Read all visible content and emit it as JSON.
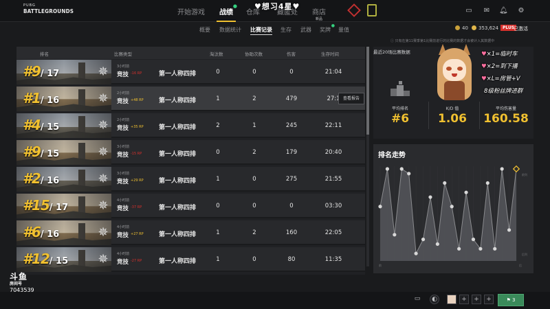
{
  "brand": {
    "small": "PUBG",
    "big": "BATTLEGROUNDS"
  },
  "nav": {
    "tabs": [
      {
        "label": "开始游戏"
      },
      {
        "label": "战绩"
      },
      {
        "label": "仓库"
      },
      {
        "label": "藏匿处"
      },
      {
        "label": "商店",
        "badge": "新品"
      }
    ]
  },
  "overlay_title": "♥想习4星♥",
  "subnav": [
    "概要",
    "数据统计",
    "比赛记录",
    "生存",
    "武器",
    "奖牌",
    "量值"
  ],
  "currency": {
    "bp": "40",
    "gcoin": "353,624"
  },
  "plus": {
    "badge": "PLUS",
    "status": "已激活"
  },
  "notice": "ⓘ 只有在第11赛季第1比赛前进行的比赛的数据才会被计入其数据中",
  "table": {
    "headers": [
      "排名",
      "比赛类型",
      "淘汰数",
      "协助次数",
      "伤害",
      "生存时间"
    ],
    "report_label": "查看报告",
    "rows": [
      {
        "rank": "#9",
        "total": "/ 17",
        "ago": "3小时前",
        "mode": "竞技",
        "rp": "-16 RP",
        "rp_dir": "down",
        "type": "第一人称四排",
        "kills": "0",
        "assists": "0",
        "damage": "0",
        "time": "21:04",
        "snow": false
      },
      {
        "rank": "#1",
        "total": "/ 16",
        "ago": "2小时前",
        "mode": "竞技",
        "rp": "+48 RP",
        "rp_dir": "up",
        "type": "第一人称四排",
        "kills": "1",
        "assists": "2",
        "damage": "479",
        "time": "27:1",
        "snow": true,
        "selected": true
      },
      {
        "rank": "#4",
        "total": "/ 15",
        "ago": "2小时前",
        "mode": "竞技",
        "rp": "+35 RP",
        "rp_dir": "up",
        "type": "第一人称四排",
        "kills": "2",
        "assists": "1",
        "damage": "245",
        "time": "22:11",
        "snow": false
      },
      {
        "rank": "#9",
        "total": "/ 15",
        "ago": "3小时前",
        "mode": "竞技",
        "rp": "-15 RP",
        "rp_dir": "down",
        "type": "第一人称四排",
        "kills": "0",
        "assists": "2",
        "damage": "179",
        "time": "20:40",
        "snow": true
      },
      {
        "rank": "#2",
        "total": "/ 16",
        "ago": "3小时前",
        "mode": "竞技",
        "rp": "+29 RP",
        "rp_dir": "up",
        "type": "第一人称四排",
        "kills": "1",
        "assists": "0",
        "damage": "275",
        "time": "21:55",
        "snow": false
      },
      {
        "rank": "#15",
        "total": "/ 17",
        "ago": "4小时前",
        "mode": "竞技",
        "rp": "-37 RP",
        "rp_dir": "down",
        "type": "第一人称四排",
        "kills": "0",
        "assists": "0",
        "damage": "0",
        "time": "03:30",
        "snow": true
      },
      {
        "rank": "#6",
        "total": "/ 16",
        "ago": "4小时前",
        "mode": "竞技",
        "rp": "+27 RP",
        "rp_dir": "up",
        "type": "第一人称四排",
        "kills": "1",
        "assists": "2",
        "damage": "160",
        "time": "22:05",
        "snow": true
      },
      {
        "rank": "#12",
        "total": "/ 15",
        "ago": "4小时前",
        "mode": "竞技",
        "rp": "-27 RP",
        "rp_dir": "down",
        "type": "第一人称四排",
        "kills": "1",
        "assists": "0",
        "damage": "80",
        "time": "11:35",
        "snow": false
      }
    ]
  },
  "stats": {
    "title": "最近20场比赛数据",
    "items": [
      {
        "label": "平均排名",
        "value": "#6"
      },
      {
        "label": "K/D 值",
        "value": "1.06"
      },
      {
        "label": "平均伤害量",
        "value": "160.58"
      }
    ]
  },
  "chart_data": {
    "type": "line",
    "title": "排名走势",
    "x": [
      1,
      2,
      3,
      4,
      5,
      6,
      7,
      8,
      9,
      10,
      11,
      12,
      13,
      14,
      15,
      16,
      17,
      18,
      19,
      20
    ],
    "series": [
      {
        "values": [
          9,
          1,
          15,
          1,
          2,
          19,
          16,
          7,
          17,
          4,
          9,
          18,
          6,
          16,
          18,
          4,
          18,
          1,
          14,
          1
        ]
      }
    ],
    "ylim": [
      1,
      20
    ],
    "y_axis_labels": [
      "前列",
      "后列"
    ],
    "x_axis_labels": [
      "前",
      "后"
    ],
    "highlight_index": 19,
    "grid": true,
    "colors": {
      "point": "#d8d8d8",
      "highlight": "#f0c030",
      "area": "#55565a"
    }
  },
  "sticker": {
    "lines": [
      {
        "glyph": "♥",
        "text": "×1=临时车"
      },
      {
        "glyph": "♥",
        "text": "×2=到下播"
      },
      {
        "glyph": "♥",
        "text": "×L=房管+V"
      },
      {
        "glyph": "",
        "text": "8级粉丝牌进群"
      }
    ]
  },
  "watermark": {
    "brand": "斗鱼",
    "sub": "房间号",
    "room": "7043539"
  },
  "bottom": {
    "squad_count": "3"
  },
  "colors": {
    "accent": "#f0c030",
    "danger": "#d8302c",
    "bg": "#1a1b1d"
  }
}
